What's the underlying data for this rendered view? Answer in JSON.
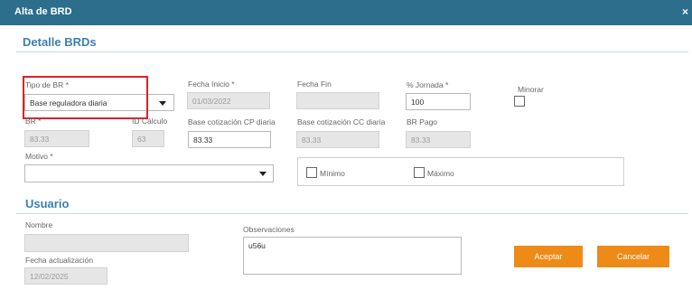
{
  "window": {
    "title": "Alta de BRD",
    "close_glyph": "×"
  },
  "sections": {
    "detalle": "Detalle BRDs",
    "usuario": "Usuario"
  },
  "tipo_br": {
    "label": "Tipo de BR *",
    "value": "Base reguladora diaria",
    "arrow_icon": "chevron-down-icon"
  },
  "fecha_inicio": {
    "label": "Fecha Inicio *",
    "value": "01/03/2022"
  },
  "fecha_fin": {
    "label": "Fecha Fin",
    "value": ""
  },
  "jornada": {
    "label": "% Jornada *",
    "value": "100"
  },
  "minorar": {
    "label": "Minorar",
    "checked": false
  },
  "br": {
    "label": "BR *",
    "value": "83.33"
  },
  "id_calculo": {
    "label": "ID Cálculo",
    "value": "63"
  },
  "base_cp": {
    "label": "Base cotización CP diaria",
    "value": "83.33"
  },
  "base_cc": {
    "label": "Base cotización CC diaria",
    "value": "83.33"
  },
  "br_pago": {
    "label": "BR Pago",
    "value": "83.33"
  },
  "motivo": {
    "label": "Motivo *",
    "value": ""
  },
  "minimo": {
    "label": "Mínimo",
    "checked": false
  },
  "maximo": {
    "label": "Máximo",
    "checked": false
  },
  "nombre": {
    "label": "Nombre",
    "value": ""
  },
  "fecha_actualizacion": {
    "label": "Fecha actualización",
    "value": "12/02/2025"
  },
  "observaciones": {
    "label": "Observaciones",
    "value": "u56u"
  },
  "buttons": {
    "aceptar": "Aceptar",
    "cancelar": "Cancelar"
  },
  "colors": {
    "titlebar": "#2c6e8c",
    "section_title": "#3c7fb0",
    "highlight": "#e2202b",
    "button": "#ee8a18"
  }
}
